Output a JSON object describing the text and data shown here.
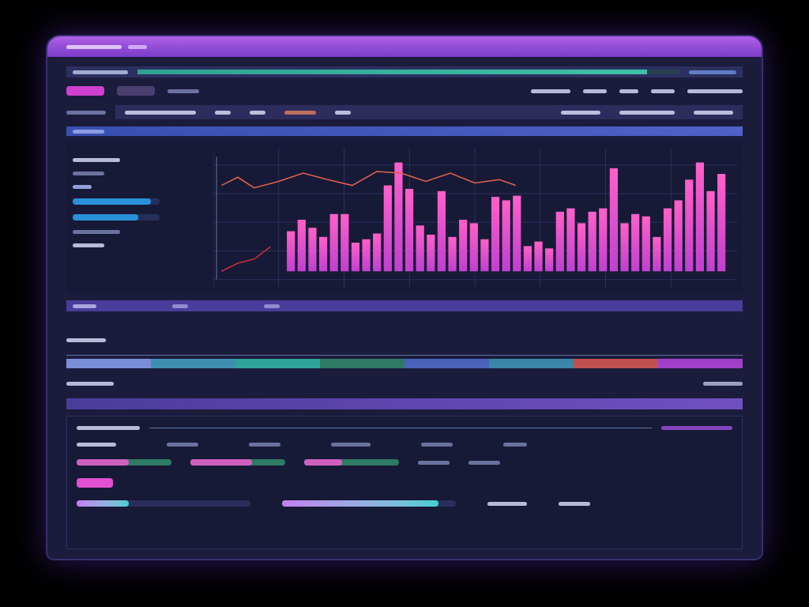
{
  "top_progress": {
    "level": 0.94
  },
  "header_tabs": [
    {
      "selected": true
    },
    {
      "selected": false
    }
  ],
  "side_bars": [
    {
      "level": 0.9
    },
    {
      "level": 0.75
    }
  ],
  "timeline_segments": [
    {
      "color": "#7a8ed8"
    },
    {
      "color": "#3f8fb0"
    },
    {
      "color": "#2fa39a"
    },
    {
      "color": "#2e7a64"
    },
    {
      "color": "#4a63b8"
    },
    {
      "color": "#3a86a8"
    },
    {
      "color": "#c05050"
    },
    {
      "color": "#a040c8"
    }
  ],
  "tracks": [
    {
      "level": 0.55
    },
    {
      "level": 0.65
    },
    {
      "level": 0.4
    }
  ],
  "bottom_bars": [
    {
      "level": 0.3
    },
    {
      "level": 0.9
    }
  ]
}
